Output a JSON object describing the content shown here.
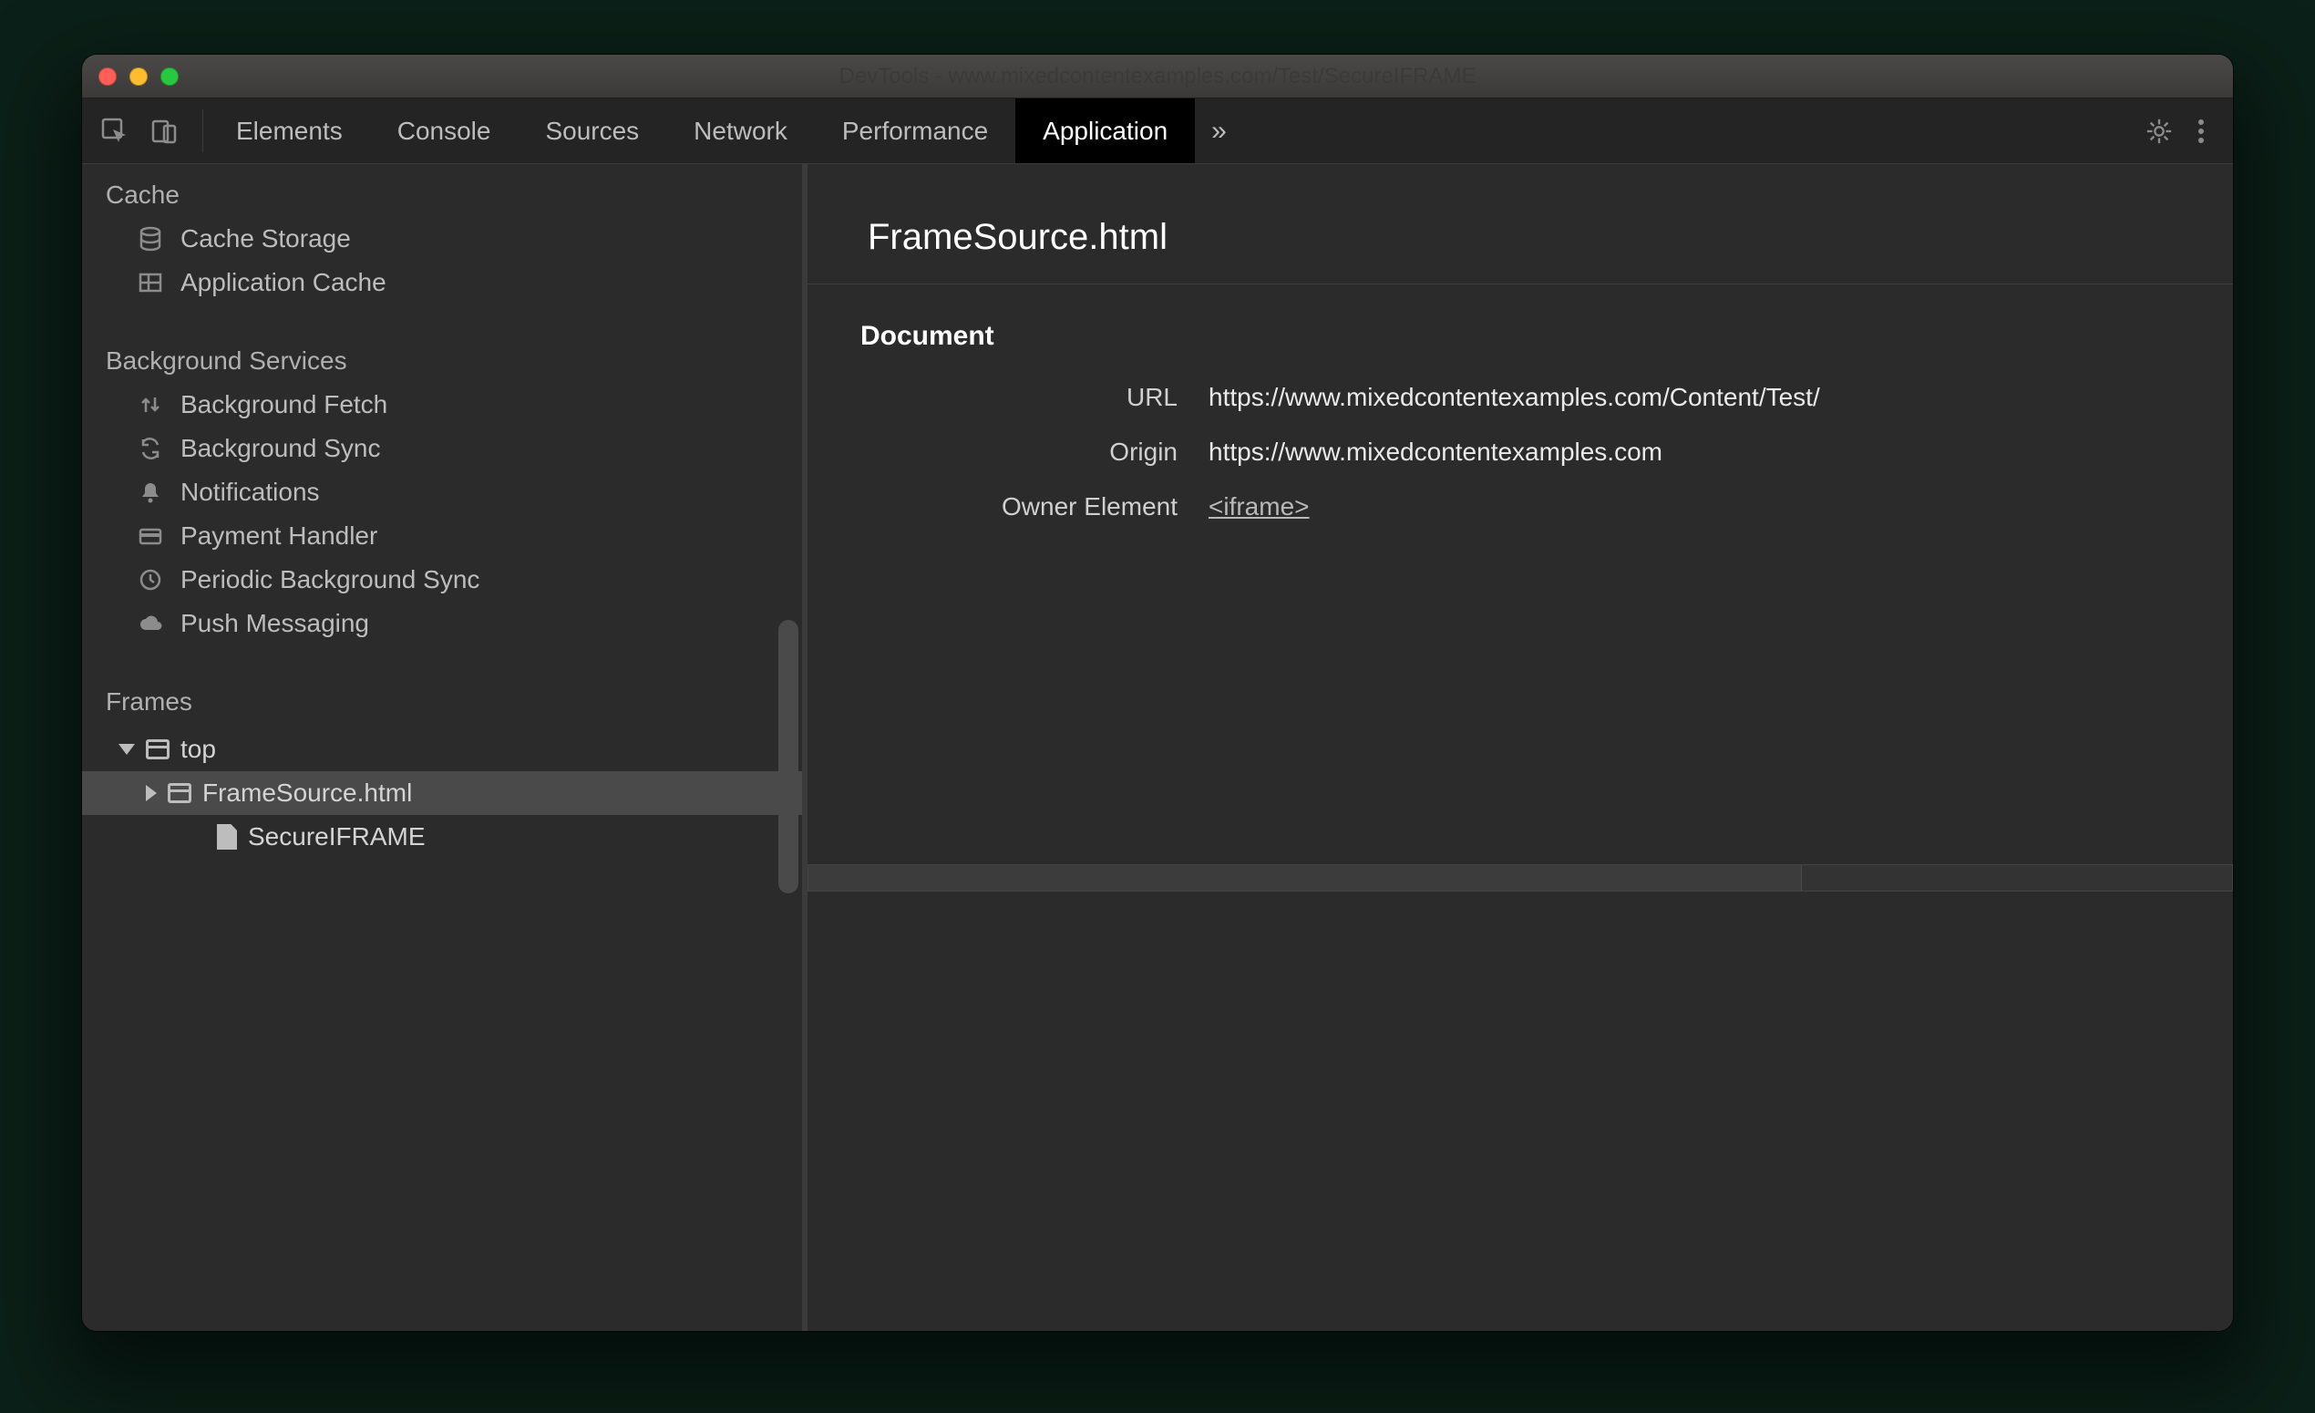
{
  "window": {
    "title": "DevTools - www.mixedcontentexamples.com/Test/SecureIFRAME"
  },
  "toolbar": {
    "tabs": {
      "elements": "Elements",
      "console": "Console",
      "sources": "Sources",
      "network": "Network",
      "performance": "Performance",
      "application": "Application"
    }
  },
  "sidebar": {
    "cache": {
      "title": "Cache",
      "items": {
        "cache_storage": "Cache Storage",
        "application_cache": "Application Cache"
      }
    },
    "background_services": {
      "title": "Background Services",
      "items": {
        "background_fetch": "Background Fetch",
        "background_sync": "Background Sync",
        "notifications": "Notifications",
        "payment_handler": "Payment Handler",
        "periodic_background_sync": "Periodic Background Sync",
        "push_messaging": "Push Messaging"
      }
    },
    "frames": {
      "title": "Frames",
      "top": "top",
      "frame_source": "FrameSource.html",
      "secure_iframe": "SecureIFRAME"
    }
  },
  "main": {
    "title": "FrameSource.html",
    "document_heading": "Document",
    "url_label": "URL",
    "url_value": "https://www.mixedcontentexamples.com/Content/Test/",
    "origin_label": "Origin",
    "origin_value": "https://www.mixedcontentexamples.com",
    "owner_element_label": "Owner Element",
    "owner_element_value": "<iframe>"
  }
}
